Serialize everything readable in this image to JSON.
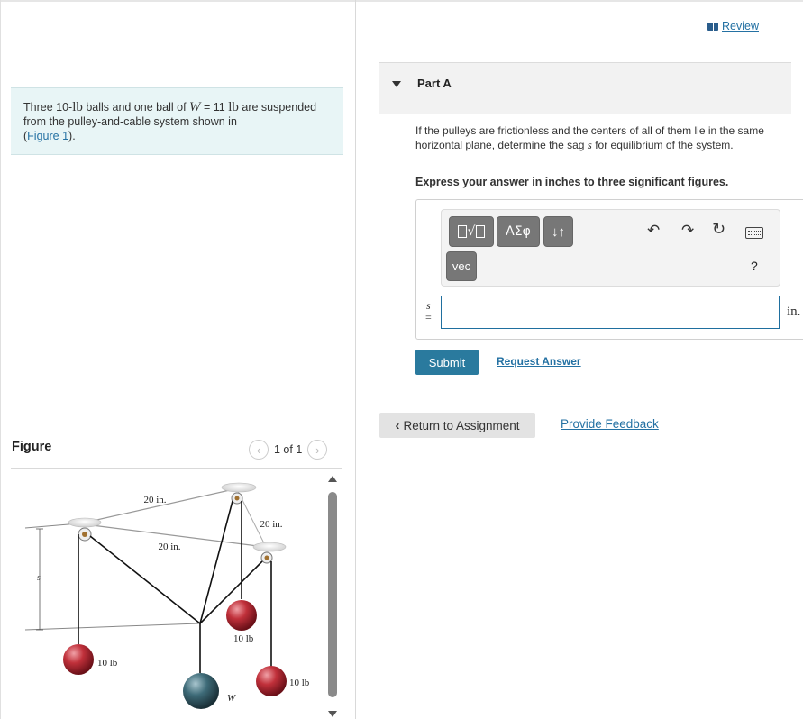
{
  "problem": {
    "intro_text": "Three 10-",
    "ball_unit": "lb",
    "mid_text": " balls and one ball of ",
    "w_symbol": "W",
    "w_eq": " = 11 ",
    "w_unit": "lb",
    "rest_text": " are suspended from the pulley-and-cable system shown in",
    "figure_link": "Figure 1",
    "open_paren": "(",
    "close_paren": ")."
  },
  "figure_panel": {
    "title": "Figure",
    "page_indicator": "1 of 1",
    "prev_icon": "chevron-left-icon",
    "next_icon": "chevron-right-icon"
  },
  "figure": {
    "dim_top": "20 in.",
    "dim_right": "20 in.",
    "dim_left": "20 in.",
    "sag_label": "s",
    "weight_left": "10 lb",
    "weight_center": "10 lb",
    "weight_right": "10 lb",
    "weight_w": "W",
    "colors": {
      "red_ball": "#c0303a",
      "blue_ball": "#3e6b78",
      "pulley": "#e0e0e0"
    }
  },
  "review": {
    "label": "Review",
    "icon": "book-icon"
  },
  "part_a": {
    "title": "Part A",
    "question_pre": "If the pulleys are frictionless and the centers of all of them lie in the same horizontal plane, determine the sag ",
    "question_var": "s",
    "question_post": " for equilibrium of the system.",
    "instruction": "Express your answer in inches to three significant figures."
  },
  "toolbar": {
    "greek_label": "ΑΣφ",
    "arrows_label": "↓↑",
    "vec_label": "vec",
    "undo_icon": "undo-icon",
    "redo_icon": "redo-icon",
    "reset_icon": "reset-icon",
    "keyboard_icon": "keyboard-icon",
    "help_label": "?"
  },
  "answer": {
    "variable": "s",
    "equals": "=",
    "value": "",
    "unit": "in."
  },
  "actions": {
    "submit_label": "Submit",
    "request_label": "Request Answer",
    "return_label": "Return to Assignment",
    "feedback_label": "Provide Feedback"
  },
  "accent_color": "#2a7a9e",
  "link_color": "#2471a3"
}
